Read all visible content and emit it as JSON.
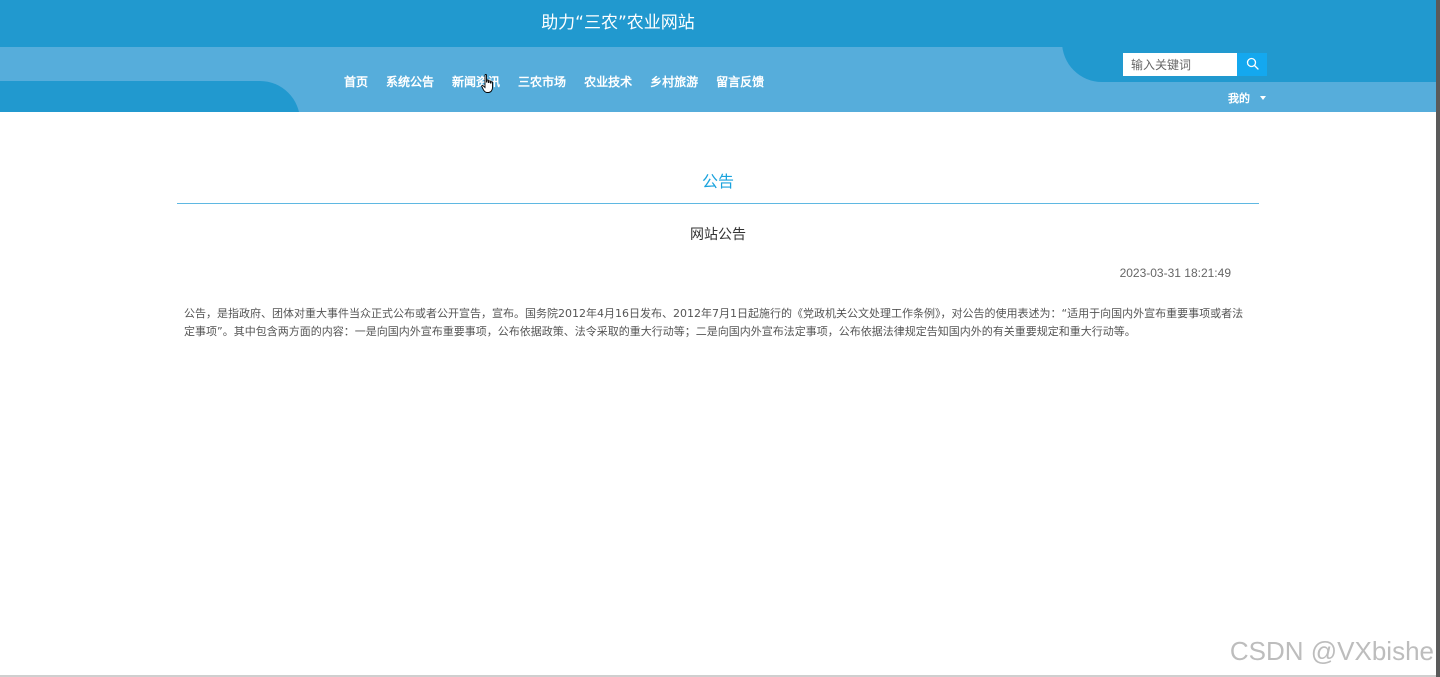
{
  "header": {
    "site_title": "助力“三农”农业网站",
    "nav_items": [
      {
        "label": "首页"
      },
      {
        "label": "系统公告"
      },
      {
        "label": "新闻资讯"
      },
      {
        "label": "三农市场"
      },
      {
        "label": "农业技术"
      },
      {
        "label": "乡村旅游"
      },
      {
        "label": "留言反馈"
      }
    ],
    "search": {
      "placeholder": "输入关键词",
      "icon": "search-icon"
    },
    "user_menu": {
      "label": "我的",
      "icon": "chevron-down-icon"
    }
  },
  "main": {
    "section_title": "公告",
    "article": {
      "title": "网站公告",
      "date": "2023-03-31 18:21:49",
      "content": "公告，是指政府、团体对重大事件当众正式公布或者公开宣告，宣布。国务院2012年4月16日发布、2012年7月1日起施行的《党政机关公文处理工作条例》，对公告的使用表述为：“适用于向国内外宣布重要事项或者法定事项”。其中包含两方面的内容：一是向国内外宣布重要事项，公布依据政策、法令采取的重大行动等；二是向国内外宣布法定事项，公布依据法律规定告知国内外的有关重要规定和重大行动等。"
    }
  },
  "watermark": "CSDN @VXbishe",
  "colors": {
    "topbar": "#2199cf",
    "navbar": "#56addb",
    "accent": "#1aa3dd",
    "search_button": "#14a8ef"
  }
}
